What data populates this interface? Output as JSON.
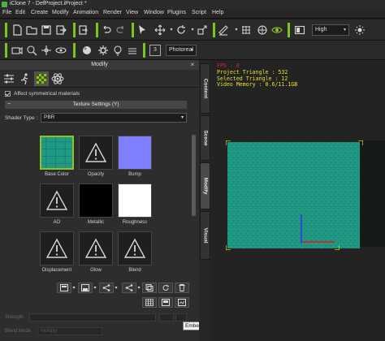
{
  "window": {
    "title": "iClone 7 - DefProject.iProject *"
  },
  "menu": [
    "File",
    "Edit",
    "Create",
    "Modify",
    "Animation",
    "Render",
    "View",
    "Window",
    "Plugins",
    "Script",
    "Help"
  ],
  "toolbar": {
    "quality_select": "High",
    "render_mode_select": "Photoreal",
    "frame_badge": "3"
  },
  "panel": {
    "title": "Modify",
    "close_glyph": "×",
    "affect_symmetrical_label": "Affect symmetrical materials",
    "affect_symmetrical_checked": true,
    "section_title": "Texture Settings  (Y)",
    "collapse_glyph": "−",
    "shader_type_label": "Shader Type :",
    "shader_type_value": "PBR",
    "slots": [
      {
        "label": "Base Color",
        "kind": "texture",
        "selected": true
      },
      {
        "label": "Opacity",
        "kind": "empty",
        "selected": false
      },
      {
        "label": "Bump",
        "kind": "bump",
        "selected": false
      },
      {
        "label": "AO",
        "kind": "empty",
        "selected": false
      },
      {
        "label": "Metallic",
        "kind": "black",
        "selected": false
      },
      {
        "label": "Roughness",
        "kind": "white",
        "selected": false
      },
      {
        "label": "Displacement",
        "kind": "empty",
        "selected": false
      },
      {
        "label": "Glow",
        "kind": "empty",
        "selected": false
      },
      {
        "label": "Blend",
        "kind": "empty",
        "selected": false
      }
    ],
    "disabled_rows": {
      "strength_label": "Strength",
      "blend_mode_label": "Blend Mode",
      "blend_mode_value": "Multiply"
    },
    "tooltip": "Embed Texture"
  },
  "side_tabs": [
    "Content",
    "Scene",
    "Modify",
    "Visual"
  ],
  "viewport": {
    "fps": "FPS : 0",
    "project_triangle": "Project Triangle : 532",
    "selected_triangle": "Selected Triangle : 12",
    "video_memory": "Video Memory : 0.6/11.1GB",
    "cube_color": "#1f9a85"
  },
  "colors": {
    "accent_green": "#7ec41f",
    "selection_green": "#8fc31f",
    "stats_red": "#d12a2a",
    "stats_yellow": "#e8e02a",
    "bump_blue": "#7f7fff"
  }
}
